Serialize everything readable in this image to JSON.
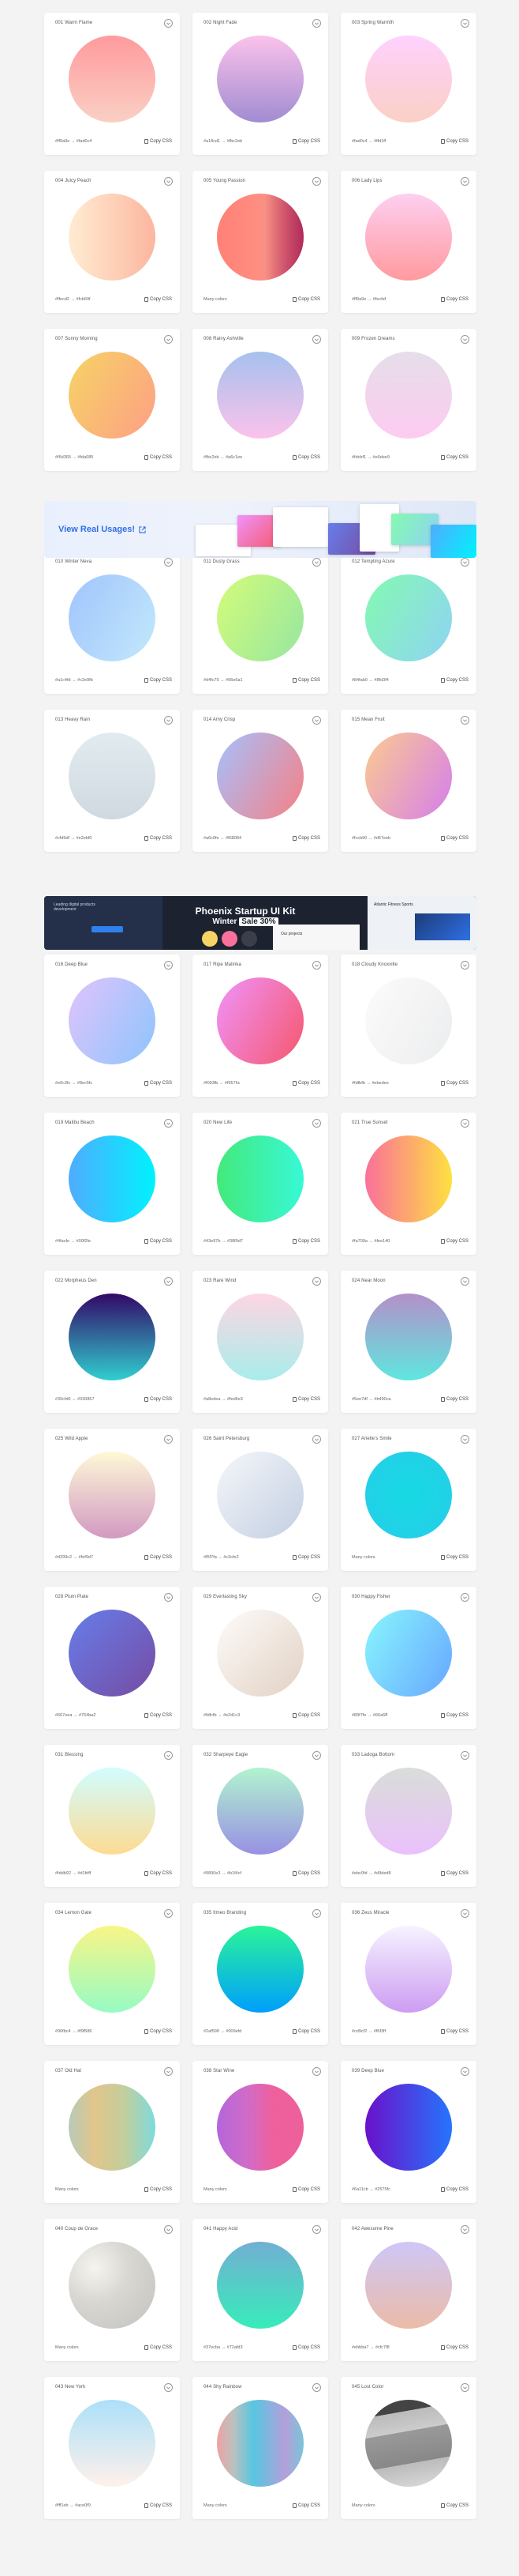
{
  "copy_label": "Copy CSS",
  "banner1": {
    "cta": "View Real Usages!"
  },
  "banner2": {
    "title": "Phoenix Startup UI Kit",
    "subtitle_pre": "Winter",
    "subtitle_badge": "Sale 30%",
    "caption_left": "Leading digital products development",
    "caption_right": "Atlantic Fitness Sports",
    "caption_mid": "Our projects"
  },
  "rows": [
    {
      "cards": [
        {
          "name": "001 Warm Flame",
          "colors": "#ff9a9e  →  #fad0c4",
          "gradient": "linear-gradient(180deg,#ff9a9e 0%,#fad0c4 100%)"
        },
        {
          "name": "002 Night Fade",
          "colors": "#a18cd1  →  #fbc2eb",
          "gradient": "linear-gradient(0deg,#a18cd1 0%,#fbc2eb 100%)"
        },
        {
          "name": "003 Spring Warmth",
          "colors": "#fad0c4  →  #ffd1ff",
          "gradient": "linear-gradient(180deg,#ffd1ff 0%,#fad0c4 100%)"
        }
      ]
    },
    {
      "cards": [
        {
          "name": "004 Juicy Peach",
          "colors": "#ffecd2  →  #fcb69f",
          "gradient": "linear-gradient(90deg,#ffecd2 0%,#fcb69f 100%)"
        },
        {
          "name": "005 Young Passion",
          "colors": "Many colors",
          "gradient": "linear-gradient(90deg,#ff8177 0%,#ff867a 20%,#ff8c7f 40%,#f99185 55%,#cf556c 78%,#b12a5b 100%)"
        },
        {
          "name": "006 Lady Lips",
          "colors": "#ff9a9e  →  #fecfef",
          "gradient": "linear-gradient(0deg,#ff9a9e 0%,#fecfef 99%)"
        }
      ]
    },
    {
      "cards": [
        {
          "name": "007 Sunny Morning",
          "colors": "#f6d365  →  #fda085",
          "gradient": "linear-gradient(120deg,#f6d365 0%,#fda085 100%)"
        },
        {
          "name": "008 Rainy Ashville",
          "colors": "#fbc2eb  →  #a6c1ee",
          "gradient": "linear-gradient(0deg,#fbc2eb 0%,#a6c1ee 100%)"
        },
        {
          "name": "009 Frozen Dreams",
          "colors": "#fdcbf1  →  #e6dee9",
          "gradient": "linear-gradient(0deg,#fdcbf1 0%,#e6dee9 100%)"
        }
      ]
    },
    {
      "cards": [
        {
          "name": "010 Winter Neva",
          "colors": "#a1c4fd  →  #c2e9fb",
          "gradient": "linear-gradient(120deg,#a1c4fd 0%,#c2e9fb 100%)"
        },
        {
          "name": "011 Dusty Grass",
          "colors": "#d4fc79  →  #96e6a1",
          "gradient": "linear-gradient(120deg,#d4fc79 0%,#96e6a1 100%)"
        },
        {
          "name": "012 Tempting Azure",
          "colors": "#84fab0  →  #8fd3f4",
          "gradient": "linear-gradient(120deg,#84fab0 0%,#8fd3f4 100%)"
        }
      ]
    },
    {
      "cards": [
        {
          "name": "013 Heavy Rain",
          "colors": "#cfd9df  →  #e2ebf0",
          "gradient": "linear-gradient(0deg,#cfd9df 0%,#e2ebf0 100%)"
        },
        {
          "name": "014 Amy Crisp",
          "colors": "#a6c0fe  →  #f68084",
          "gradient": "linear-gradient(120deg,#a6c0fe 0%,#f68084 100%)"
        },
        {
          "name": "015 Mean Fruit",
          "colors": "#fccb90  →  #d57eeb",
          "gradient": "linear-gradient(120deg,#fccb90 0%,#d57eeb 100%)"
        }
      ]
    },
    {
      "cards": [
        {
          "name": "016 Deep Blue",
          "colors": "#e0c3fc  →  #8ec5fc",
          "gradient": "linear-gradient(120deg,#e0c3fc 0%,#8ec5fc 100%)"
        },
        {
          "name": "017 Ripe Malinka",
          "colors": "#f093fb  →  #f5576c",
          "gradient": "linear-gradient(120deg,#f093fb 0%,#f5576c 100%)"
        },
        {
          "name": "018 Cloudy Knoxville",
          "colors": "#fdfbfb  →  #ebedee",
          "gradient": "linear-gradient(120deg,#fdfbfb 0%,#ebedee 100%)"
        }
      ]
    },
    {
      "cards": [
        {
          "name": "019 Malibu Beach",
          "colors": "#4facfe  →  #00f2fe",
          "gradient": "linear-gradient(to right,#4facfe 0%,#00f2fe 100%)"
        },
        {
          "name": "020 New Life",
          "colors": "#43e97b  →  #38f9d7",
          "gradient": "linear-gradient(to right,#43e97b 0%,#38f9d7 100%)"
        },
        {
          "name": "021 True Sunset",
          "colors": "#fa709a  →  #fee140",
          "gradient": "linear-gradient(to right,#fa709a 0%,#fee140 100%)"
        }
      ]
    },
    {
      "cards": [
        {
          "name": "022 Morpheus Den",
          "colors": "#30cfd0  →  #330867",
          "gradient": "linear-gradient(to top,#30cfd0 0%,#330867 100%)"
        },
        {
          "name": "023 Rare Wind",
          "colors": "#a8edea  →  #fed6e3",
          "gradient": "linear-gradient(to top,#a8edea 0%,#fed6e3 100%)"
        },
        {
          "name": "024 Near Moon",
          "colors": "#5ee7df  →  #b490ca",
          "gradient": "linear-gradient(to top,#5ee7df 0%,#b490ca 100%)"
        }
      ]
    },
    {
      "cards": [
        {
          "name": "025 Wild Apple",
          "colors": "#d299c2  →  #fef9d7",
          "gradient": "linear-gradient(to top,#d299c2 0%,#fef9d7 100%)"
        },
        {
          "name": "026 Saint Petersburg",
          "colors": "#f5f7fa  →  #c3cfe2",
          "gradient": "linear-gradient(135deg,#f5f7fa 0%,#c3cfe2 100%)"
        },
        {
          "name": "027 Arielle's Smile",
          "colors": "Many colors",
          "gradient": "radial-gradient(circle 248px at center,#16d9e3 0%,#30c7ec 47%,#46aef7 100%)"
        }
      ]
    },
    {
      "cards": [
        {
          "name": "028 Plum Plate",
          "colors": "#667eea  →  #764ba2",
          "gradient": "linear-gradient(135deg,#667eea 0%,#764ba2 100%)"
        },
        {
          "name": "029 Everlasting Sky",
          "colors": "#fdfcfb  →  #e2d1c3",
          "gradient": "linear-gradient(135deg,#fdfcfb 0%,#e2d1c3 100%)"
        },
        {
          "name": "030 Happy Fisher",
          "colors": "#89f7fe  →  #66a6ff",
          "gradient": "linear-gradient(120deg,#89f7fe 0%,#66a6ff 100%)"
        }
      ]
    },
    {
      "cards": [
        {
          "name": "031 Blessing",
          "colors": "#fddb92  →  #d1fdff",
          "gradient": "linear-gradient(to top,#fddb92 0%,#d1fdff 100%)"
        },
        {
          "name": "032 Sharpeye Eagle",
          "colors": "#9890e3  →  #b1f4cf",
          "gradient": "linear-gradient(to top,#9890e3 0%,#b1f4cf 100%)"
        },
        {
          "name": "033 Ladoga Bottom",
          "colors": "#ebc0fd  →  #d9ded8",
          "gradient": "linear-gradient(to top,#ebc0fd 0%,#d9ded8 100%)"
        }
      ]
    },
    {
      "cards": [
        {
          "name": "034 Lemon Gate",
          "colors": "#96fbc4  →  #f9f586",
          "gradient": "linear-gradient(to top,#96fbc4 0%,#f9f586 100%)"
        },
        {
          "name": "035 Itmeo Branding",
          "colors": "#2af598  →  #009efd",
          "gradient": "linear-gradient(180deg,#2af598 0%,#009efd 100%)"
        },
        {
          "name": "036 Zeus Miracle",
          "colors": "#cd9cf2  →  #f6f3ff",
          "gradient": "linear-gradient(to top,#cd9cf2 0%,#f6f3ff 100%)"
        }
      ]
    },
    {
      "cards": [
        {
          "name": "037 Old Hat",
          "colors": "Many colors",
          "gradient": "linear-gradient(to right,#e4afcb 0%,#b8cbb8 0%,#b8cbb8 0%,#e2c58b 30%,#c2ce9c 64%,#7edbdc 100%)"
        },
        {
          "name": "038 Star Wine",
          "colors": "Many colors",
          "gradient": "linear-gradient(to right,#b8cbb8 0%,#b8cbb8 0%,#b465da 0%,#cf6cc9 33%,#ee609c 66%,#ee609c 100%)"
        },
        {
          "name": "039 Deep Blue",
          "colors": "#6a11cb  →  #2575fc",
          "gradient": "linear-gradient(to right,#6a11cb 0%,#2575fc 100%)"
        }
      ]
    },
    {
      "cards": [
        {
          "name": "040 Coup de Grace",
          "colors": "Many colors",
          "gradient": "radial-gradient(circle at 30% 30%,#f5f5f0 0%,#d9d7d2 40%,#c4c2bc 100%)"
        },
        {
          "name": "041 Happy Acid",
          "colors": "#37ecba  →  #72afd3",
          "gradient": "linear-gradient(to top,#37ecba 0%,#72afd3 100%)"
        },
        {
          "name": "042 Awesome Pine",
          "colors": "#ebbba7  →  #cfc7f8",
          "gradient": "linear-gradient(to top,#ebbba7 0%,#cfc7f8 100%)"
        }
      ]
    },
    {
      "cards": [
        {
          "name": "043 New York",
          "colors": "#fff1eb  →  #ace0f9",
          "gradient": "linear-gradient(to top,#fff1eb 0%,#ace0f9 100%)"
        },
        {
          "name": "044 Shy Rainbow",
          "colors": "Many colors",
          "gradient": "linear-gradient(to right,#eea2a2 0%,#bbc1bf 19%,#57c6e1 42%,#b49fda 79%,#7ac5d8 100%)"
        },
        {
          "name": "045 Lost Color",
          "colors": "Many colors",
          "gradient": "linear-gradient(170deg,#444 0%,#444 18%,#bbb 18%,#ccc 38%,#999 38%,#888 70%,#bbb 70%,#ddd 100%)"
        }
      ]
    }
  ]
}
